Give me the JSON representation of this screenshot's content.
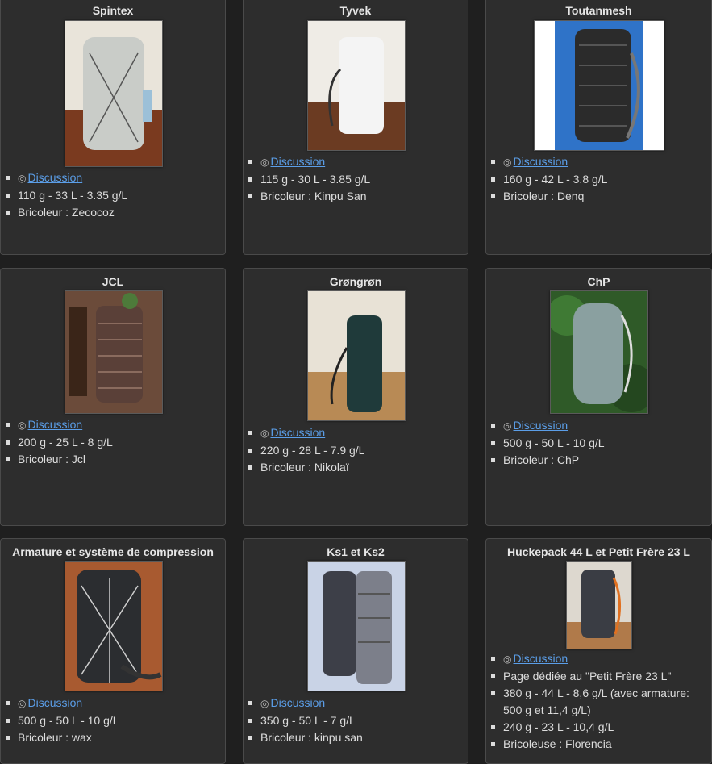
{
  "cards": [
    {
      "title": "Spintex",
      "discussion_label": "Discussion",
      "specs": "110 g - 33 L - 3.35 g/L",
      "maker": "Bricoleur : Zecocoz"
    },
    {
      "title": "Tyvek",
      "discussion_label": "Discussion",
      "specs": "115 g - 30 L - 3.85 g/L",
      "maker": "Bricoleur : Kinpu San"
    },
    {
      "title": "Toutanmesh",
      "discussion_label": "Discussion",
      "specs": "160 g - 42 L - 3.8 g/L",
      "maker": "Bricoleur : Denq"
    },
    {
      "title": "JCL",
      "discussion_label": "Discussion",
      "specs": "200 g - 25 L - 8 g/L",
      "maker": "Bricoleur : Jcl"
    },
    {
      "title": "Grøngrøn",
      "discussion_label": "Discussion",
      "specs": "220 g - 28 L - 7.9 g/L",
      "maker": "Bricoleur : Nikolaï"
    },
    {
      "title": "ChP",
      "discussion_label": "Discussion",
      "specs": "500 g - 50 L - 10 g/L",
      "maker": "Bricoleur : ChP"
    },
    {
      "title": "Armature et système de compression",
      "discussion_label": "Discussion",
      "specs": "500 g - 50 L - 10 g/L",
      "maker": "Bricoleur : wax"
    },
    {
      "title": "Ks1 et Ks2",
      "discussion_label": "Discussion",
      "specs": "350 g - 50 L - 7 g/L",
      "maker": "Bricoleur : kinpu san"
    },
    {
      "title": "Huckepack 44 L et Petit Frère 23 L",
      "discussion_label": "Discussion",
      "page_link": "Page dédiée au \"Petit Frère 23 L\"",
      "specs": "380 g - 44 L - 8,6 g/L (avec armature: 500 g et 11,4 g/L)",
      "specs2": "240 g - 23 L - 10,4 g/L",
      "maker": "Bricoleuse : Florencia"
    }
  ]
}
